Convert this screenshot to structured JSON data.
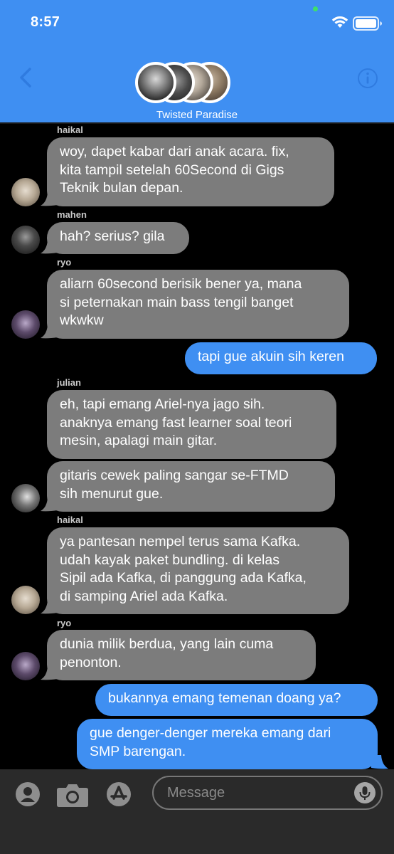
{
  "status_bar": {
    "time": "8:57"
  },
  "header": {
    "group_name": "Twisted Paradise"
  },
  "messages": [
    {
      "sender": "haikal",
      "text": "woy, dapet kabar dari anak acara. fix,\nkita tampil setelah 60Second di Gigs\nTeknik bulan depan."
    },
    {
      "sender": "mahen",
      "text": "hah? serius? gila"
    },
    {
      "sender": "ryo",
      "text": "aliarn 60second berisik bener ya, mana\nsi peternakan main bass tengil banget\nwkwkw"
    },
    {
      "sender": "me",
      "text": "tapi gue akuin sih keren"
    },
    {
      "sender": "julian",
      "text": "eh, tapi emang Ariel-nya jago sih.\nanaknya emang fast learner soal teori\nmesin, apalagi main gitar."
    },
    {
      "sender": "julian",
      "text": "gitaris cewek paling sangar se-FTMD\nsih menurut gue."
    },
    {
      "sender": "haikal",
      "text": "ya pantesan nempel terus sama Kafka.\nudah kayak paket bundling. di kelas\nSipil ada Kafka, di panggung ada Kafka,\ndi samping Ariel ada Kafka."
    },
    {
      "sender": "ryo",
      "text": "dunia milik berdua, yang lain cuma\npenonton."
    },
    {
      "sender": "me",
      "text": "bukannya emang temenan doang ya?"
    },
    {
      "sender": "me",
      "text": "gue denger-denger mereka emang dari\nSMP barengan."
    }
  ],
  "composer": {
    "placeholder": "Message"
  },
  "colors": {
    "accent": "#3f8ff2",
    "incoming": "#7c7c7c",
    "background": "#000000"
  },
  "icons": [
    "back-chevron-icon",
    "info-icon",
    "wifi-icon",
    "battery-icon",
    "avatar-icon",
    "camera-icon",
    "app-store-icon",
    "microphone-icon"
  ]
}
